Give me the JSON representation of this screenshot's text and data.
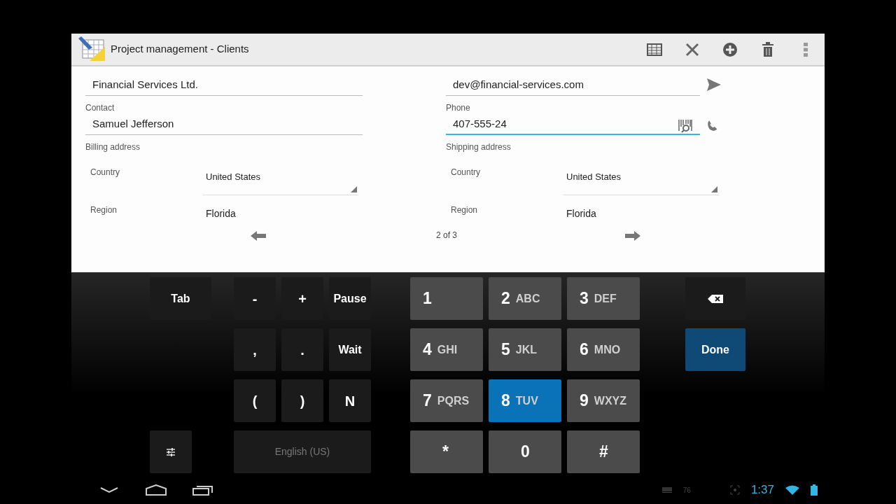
{
  "title_bar": {
    "title": "Project management - Clients"
  },
  "form": {
    "rows": [
      [
        {
          "value": "Financial Services Ltd.",
          "focused": false
        },
        {
          "value": "dev@financial-services.com",
          "focused": false,
          "kind": "send"
        }
      ],
      [
        {
          "label": "Contact",
          "value": "Samuel Jefferson",
          "focused": false
        },
        {
          "label": "Phone",
          "value": "407-555-24",
          "focused": true,
          "kind": "call",
          "scan": true
        }
      ]
    ],
    "addresses": [
      {
        "title": "Billing address",
        "country_label": "Country",
        "country": "United States",
        "region_label": "Region",
        "region": "Florida"
      },
      {
        "title": "Shipping address",
        "country_label": "Country",
        "country": "United States",
        "region_label": "Region",
        "region": "Florida"
      }
    ],
    "pager": {
      "text": "2 of 3"
    }
  },
  "keyboard": {
    "tab_key": "Tab",
    "symbol_rows": [
      [
        "-",
        "+",
        "Pause"
      ],
      [
        ",",
        ".",
        "Wait"
      ],
      [
        "(",
        ")",
        "N"
      ]
    ],
    "language": "English (US)",
    "number_keys": [
      {
        "digit": "1",
        "pressed": false
      },
      {
        "digit": "2",
        "letters": "ABC",
        "pressed": false
      },
      {
        "digit": "3",
        "letters": "DEF",
        "pressed": false
      },
      {
        "digit": "4",
        "letters": "GHI",
        "pressed": false
      },
      {
        "digit": "5",
        "letters": "JKL",
        "pressed": false
      },
      {
        "digit": "6",
        "letters": "MNO",
        "pressed": false
      },
      {
        "digit": "7",
        "letters": "PQRS",
        "pressed": false
      },
      {
        "digit": "8",
        "letters": "TUV",
        "pressed": true
      },
      {
        "digit": "9",
        "letters": "WXYZ",
        "pressed": false
      },
      {
        "digit": "*",
        "pressed": false
      },
      {
        "digit": "0",
        "pressed": false
      },
      {
        "digit": "#",
        "pressed": false
      }
    ],
    "done": "Done"
  },
  "status_bar": {
    "indicator": "76",
    "time": "1:37"
  }
}
